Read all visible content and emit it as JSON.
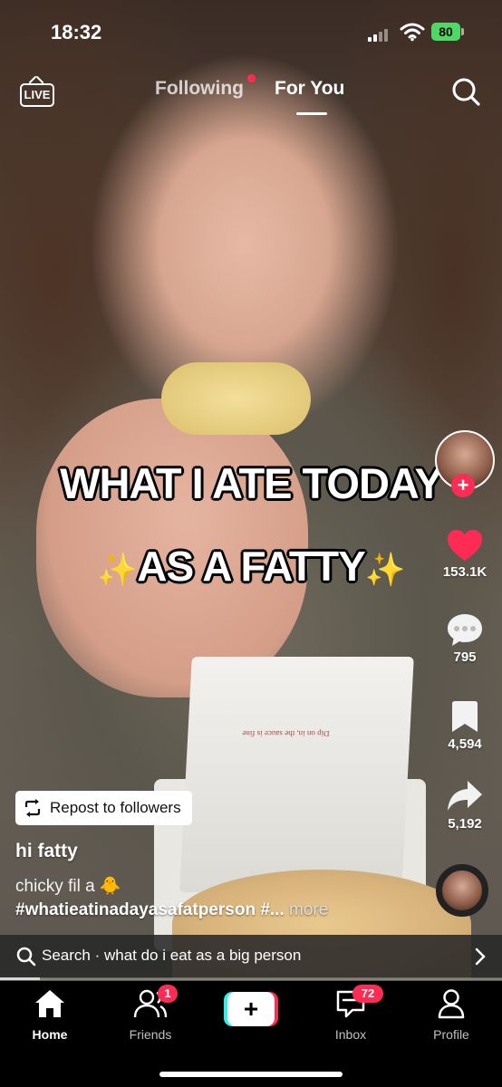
{
  "status_bar": {
    "time": "18:32",
    "battery": "80"
  },
  "top_nav": {
    "live_label": "LIVE",
    "tabs": [
      {
        "label": "Following"
      },
      {
        "label": "For You"
      }
    ],
    "active_tab": "For You"
  },
  "video": {
    "overlay_line1": "WHAT I ATE TODAY",
    "overlay_line2": "AS A FATTY",
    "sparkle": "✨",
    "box_print": "Dip on in, the sauce is fine"
  },
  "actions": {
    "likes": "153.1K",
    "comments": "795",
    "saves": "4,594",
    "shares": "5,192"
  },
  "post": {
    "repost_label": "Repost to followers",
    "username": "hi fatty",
    "caption": "chicky fil a 🐥",
    "hashtags": "#whatieatinadayasafatperson #...",
    "more_label": "more"
  },
  "search_suggestion": {
    "text": "Search · what do i eat as a big person"
  },
  "video_progress": 0.08,
  "bottom_nav": {
    "items": [
      {
        "label": "Home"
      },
      {
        "label": "Friends",
        "badge": "1"
      },
      {
        "label": ""
      },
      {
        "label": "Inbox",
        "badge": "72"
      },
      {
        "label": "Profile"
      }
    ]
  },
  "colors": {
    "accent": "#fe2c55",
    "cyan": "#25f4ee",
    "battery": "#4cd964"
  }
}
